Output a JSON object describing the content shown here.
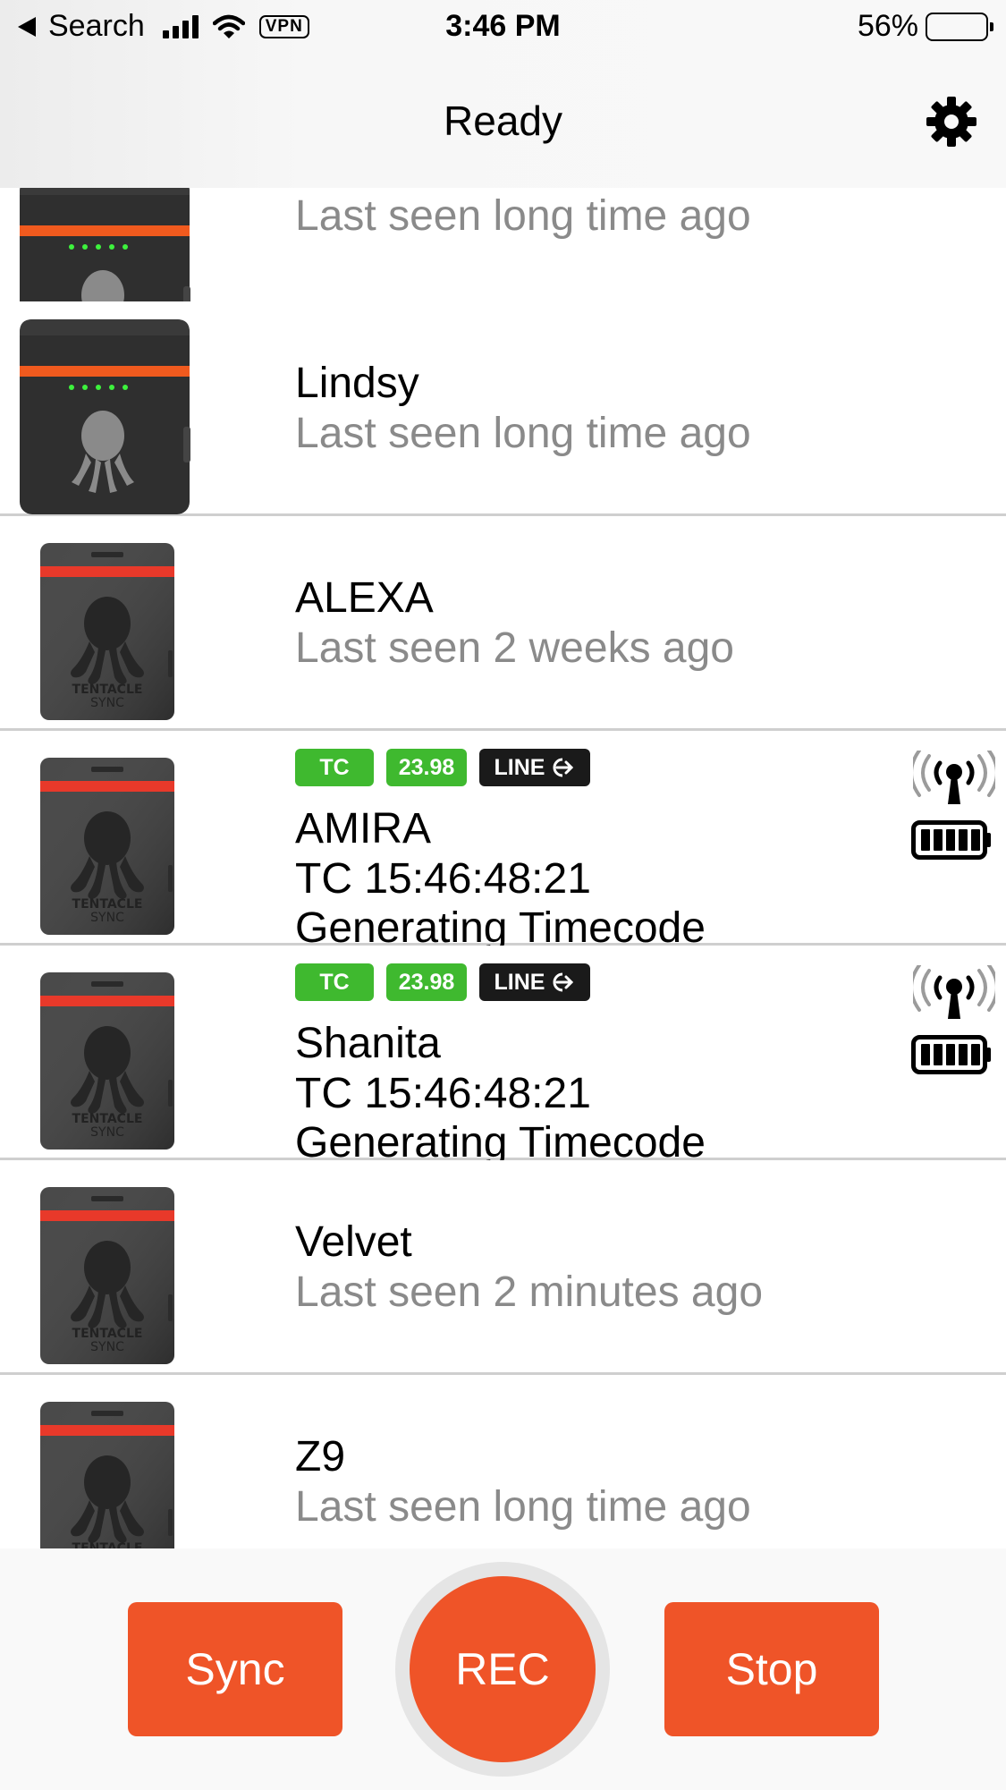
{
  "status_bar": {
    "back_label": "Search",
    "vpn": "VPN",
    "time": "3:46 PM",
    "battery_percent": "56%",
    "battery_level": 0.56
  },
  "nav": {
    "title": "Ready",
    "settings_icon": "gear-icon"
  },
  "devices": [
    {
      "name": "",
      "sub": "Last seen long time ago"
    },
    {
      "name": "Lindsy",
      "sub": "Last seen long time ago"
    },
    {
      "name": "ALEXA",
      "sub": "Last seen 2 weeks ago"
    },
    {
      "name": "AMIRA",
      "badges": [
        "TC",
        "23.98",
        "LINE"
      ],
      "tc": "TC 15:46:48:21",
      "state": "Generating Timecode"
    },
    {
      "name": "Shanita",
      "badges": [
        "TC",
        "23.98",
        "LINE"
      ],
      "tc": "TC 15:46:48:21",
      "state": "Generating Timecode"
    },
    {
      "name": "Velvet",
      "sub": "Last seen 2 minutes ago"
    },
    {
      "name": "Z9",
      "sub": "Last seen long time ago"
    }
  ],
  "device_image_text": [
    "TENTACLE",
    "SYNC"
  ],
  "bottom_bar": {
    "sync_label": "Sync",
    "rec_label": "REC",
    "stop_label": "Stop"
  },
  "colors": {
    "accent": "#ef5428",
    "badge_green": "#3fb92f",
    "badge_black": "#1a1a1a",
    "secondary_text": "#8a8a8a"
  }
}
